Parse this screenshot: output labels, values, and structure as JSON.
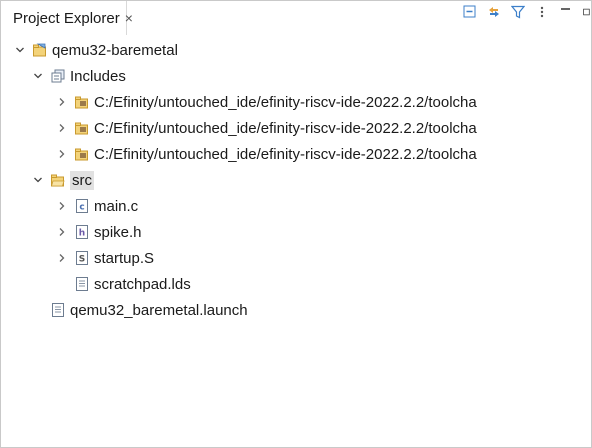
{
  "tab": {
    "title": "Project Explorer",
    "close": "×"
  },
  "toolbar": {
    "collapse_all": "collapse-all-icon",
    "link_with_editor": "link-with-editor-icon",
    "filter": "filter-icon",
    "view_menu": "view-menu-icon",
    "minimize": "minimize-icon",
    "maximize": "maximize-icon"
  },
  "tree": {
    "project": "qemu32-baremetal",
    "includes": "Includes",
    "include_paths": [
      "C:/Efinity/untouched_ide/efinity-riscv-ide-2022.2.2/toolcha",
      "C:/Efinity/untouched_ide/efinity-riscv-ide-2022.2.2/toolcha",
      "C:/Efinity/untouched_ide/efinity-riscv-ide-2022.2.2/toolcha"
    ],
    "src": "src",
    "files": {
      "main": "main.c",
      "spike": "spike.h",
      "startup": "startup.S",
      "scratchpad": "scratchpad.lds"
    },
    "launch": "qemu32_baremetal.launch"
  },
  "colors": {
    "project_folder": "#c99a2e",
    "c_file": "#4a6fb0",
    "header_file": "#6b5aa8",
    "toolbar": "#3c7fc9"
  }
}
